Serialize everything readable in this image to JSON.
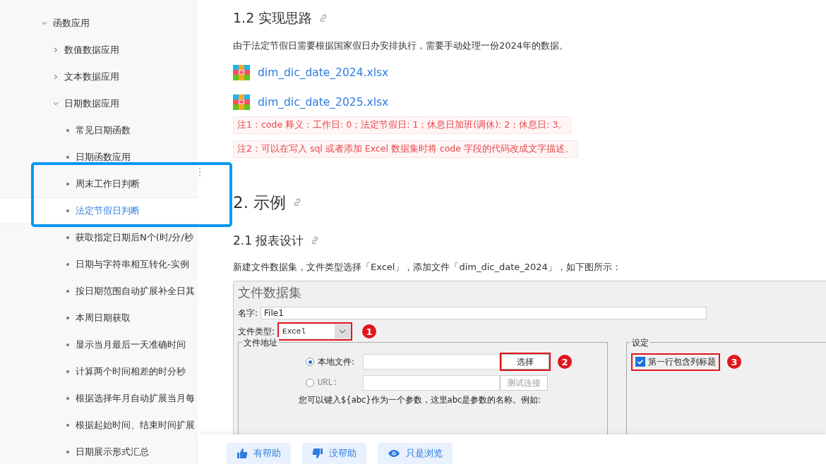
{
  "sidebar": {
    "items": [
      {
        "label": "函数应用",
        "expanded": true,
        "selected": false,
        "children": [
          {
            "label": "数值数据应用",
            "expanded": false,
            "selected": false
          },
          {
            "label": "文本数据应用",
            "expanded": false,
            "selected": false
          },
          {
            "label": "日期数据应用",
            "expanded": true,
            "selected": false,
            "children": [
              {
                "label": "常见日期函数",
                "selected": false
              },
              {
                "label": "日期函数应用",
                "selected": false
              },
              {
                "label": "周末工作日判断",
                "selected": false
              },
              {
                "label": "法定节假日判断",
                "selected": true
              },
              {
                "label": "获取指定日期后N个(时/分/秒",
                "selected": false
              },
              {
                "label": "日期与字符串相互转化-实例",
                "selected": false
              },
              {
                "label": "按日期范围自动扩展补全日其",
                "selected": false
              },
              {
                "label": "本周日期获取",
                "selected": false
              },
              {
                "label": "显示当月最后一天准确时间",
                "selected": false
              },
              {
                "label": "计算两个时间相差的时分秒",
                "selected": false
              },
              {
                "label": "根据选择年月自动扩展当月每",
                "selected": false
              },
              {
                "label": "根据起始时间、结束时间扩展",
                "selected": false
              },
              {
                "label": "日期展示形式汇总",
                "selected": false
              }
            ]
          }
        ]
      }
    ]
  },
  "content": {
    "heading_1": "1.2 实现思路",
    "paragraph_1": "由于法定节假日需要根据国家假日办安排执行，需要手动处理一份2024年的数据。",
    "files": [
      "dim_dic_date_2024.xlsx",
      "dim_dic_date_2025.xlsx"
    ],
    "notes": [
      "注1：code 释义：工作日: 0；法定节假日: 1；休息日加班(调休): 2；休息日: 3。",
      "注2：可以在写入 sql 或者添加 Excel 数据集时将 code 字段的代码改成文字描述。"
    ],
    "heading_2": "2. 示例",
    "heading_3": "2.1 报表设计",
    "paragraph_2": "新建文件数据集，文件类型选择「Excel」，添加文件「dim_dic_date_2024」，如下图所示：",
    "dialog": {
      "title": "文件数据集",
      "name_label": "名字:",
      "name_value": "File1",
      "type_label": "文件类型:",
      "type_value": "Excel",
      "address_group": "文件地址",
      "sources": [
        {
          "label": "本地文件:",
          "selected": true,
          "button": "选择",
          "button_disabled": false
        },
        {
          "label": "URL:",
          "selected": false,
          "button": "测试连接",
          "button_disabled": true
        }
      ],
      "hint": "您可以键入${abc}作为一个参数，这里abc是参数的名称。例如:",
      "settings_group": "设定",
      "header_checkbox": {
        "label": "第一行包含列标题",
        "checked": true
      },
      "markers": [
        "1",
        "2",
        "3"
      ]
    }
  },
  "feedback": [
    {
      "kind": "up",
      "label": "有帮助"
    },
    {
      "kind": "down",
      "label": "没帮助"
    },
    {
      "kind": "eye",
      "label": "只是浏览"
    }
  ]
}
